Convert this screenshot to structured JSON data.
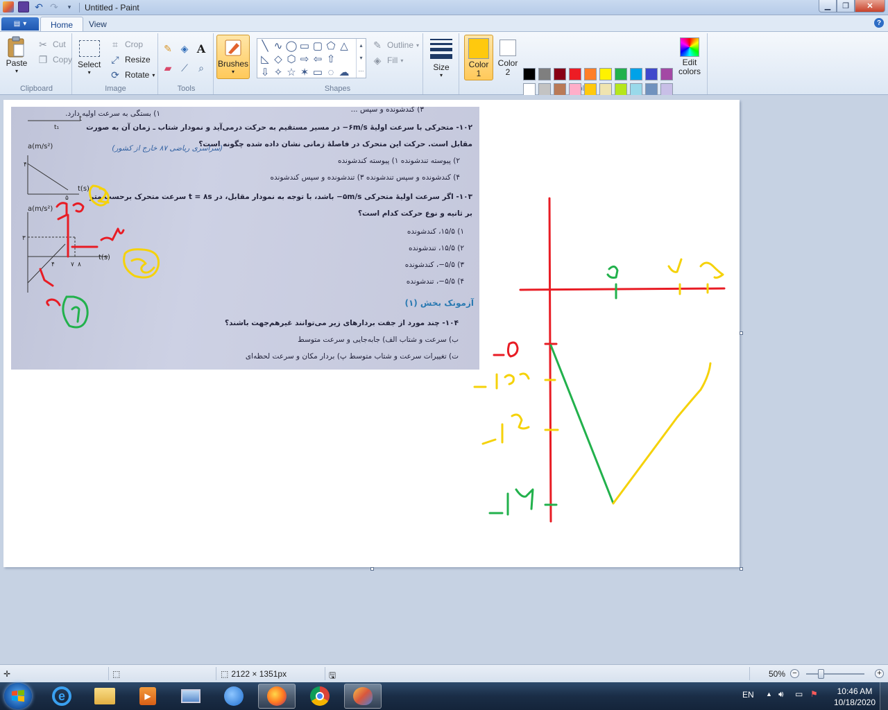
{
  "window": {
    "title": "Untitled - Paint",
    "controls": {
      "minimize": "minimize-icon",
      "maximize": "maximize-icon",
      "close": "close-icon"
    }
  },
  "quick_access": [
    "save-icon",
    "undo-icon",
    "redo-icon",
    "customize-icon"
  ],
  "tabs": [
    {
      "label": "Home",
      "active": true
    },
    {
      "label": "View",
      "active": false
    }
  ],
  "ribbon": {
    "clipboard": {
      "label": "Clipboard",
      "paste": "Paste",
      "cut": "Cut",
      "copy": "Copy"
    },
    "image": {
      "label": "Image",
      "select": "Select",
      "crop": "Crop",
      "resize": "Resize",
      "rotate": "Rotate"
    },
    "tools": {
      "label": "Tools",
      "items": [
        "pencil-icon",
        "fill-bucket-icon",
        "text-icon",
        "eraser-icon",
        "color-picker-icon",
        "magnifier-icon"
      ],
      "text_glyph": "A"
    },
    "brushes": {
      "label": "Brushes"
    },
    "shapes": {
      "label": "Shapes",
      "outline": "Outline",
      "fill": "Fill",
      "glyphs": [
        "╲",
        "∿",
        "◯",
        "▭",
        "▢",
        "⬠",
        "△",
        "◺",
        "◇",
        "⬡",
        "⇨",
        "⇦",
        "⇧",
        "⇩",
        "✧",
        "☆",
        "✶",
        "▭",
        "◌",
        "☁"
      ]
    },
    "size": {
      "label": "Size"
    },
    "colors": {
      "label": "Colors",
      "color1_label": "Color",
      "color1_num": "1",
      "color2_label": "Color",
      "color2_num": "2",
      "color1_value": "#ffc90e",
      "color2_value": "#ffffff",
      "edit_label": "Edit",
      "edit_label2": "colors",
      "palette_row1": [
        "#000000",
        "#7f7f7f",
        "#880015",
        "#ed1c24",
        "#ff7f27",
        "#fff200",
        "#22b14c",
        "#00a2e8",
        "#3f48cc",
        "#a349a4"
      ],
      "palette_row2": [
        "#ffffff",
        "#c3c3c3",
        "#b97a57",
        "#ffaec9",
        "#ffc90e",
        "#efe4b0",
        "#b5e61d",
        "#99d9ea",
        "#7092be",
        "#c8bfe7"
      ]
    }
  },
  "photo": {
    "lines": [
      {
        "t": "۳) کندشونده و سپس ...",
        "b": false
      },
      {
        "t": "۱) بستگی به سرعت اولیه دارد.",
        "b": false
      },
      {
        "t": "۱۰۲- متحرکی با سرعت اولیهٔ ۶m/s− در مسیر مستقیم به حرکت درمی‌آید و نمودار شتاب ـ زمان آن به صورت",
        "b": true
      },
      {
        "t": "مقابل است. حرکت این متحرک در فاصلهٔ زمانی نشان داده شده چگونه است؟",
        "b": true
      },
      {
        "t": "(سراسری ریاضی ۸۷ خارج از کشور)",
        "b": false,
        "blue": true
      },
      {
        "t": "۲) پیوسته تندشونده        ۱) پیوسته کندشونده",
        "b": false
      },
      {
        "t": "۴) کندشونده و سپس تندشونده        ۳) تندشونده و سپس کندشونده",
        "b": false
      },
      {
        "t": "۱۰۳- اگر سرعت اولیهٔ متحرکی ۵m/s− باشد، با توجه به نمودار مقابل، در t = ۸s سرعت متحرک برحسب متر",
        "b": true
      },
      {
        "t": "بر ثانیه و نوع حرکت کدام است؟",
        "b": true
      },
      {
        "t": "۱) ۱۵/۵، کندشونده",
        "b": false
      },
      {
        "t": "۲) ۱۵/۵، تندشونده",
        "b": false
      },
      {
        "t": "۳) ۵/۵−، کندشونده",
        "b": false
      },
      {
        "t": "۴) ۵/۵−، تندشونده",
        "b": false
      },
      {
        "t": "آزمونک بخش (۱)",
        "b": true,
        "heading": true
      },
      {
        "t": "۱۰۴- چند مورد از جفت بردارهای زیر می‌توانند غیرهم‌جهت باشند؟",
        "b": true
      },
      {
        "t": "ب) سرعت و شتاب        الف) جابه‌جایی و سرعت متوسط",
        "b": false
      },
      {
        "t": "ت) تغییرات سرعت و شتاب متوسط        پ) بردار مکان و سرعت لحظه‌ای",
        "b": false
      }
    ],
    "graph_labels": {
      "a1": "a(m/s²)",
      "t1": "t(s)",
      "a2": "a(m/s²)",
      "t2": "t(s)",
      "t": "t",
      "t1sub": "t₁",
      "four": "۴",
      "five": "۵",
      "three": "۳",
      "seven": "۷",
      "eight": "۸",
      "four2": "۴"
    }
  },
  "statusbar": {
    "dimensions": "2122 × 1351px",
    "zoom": "50%"
  },
  "taskbar": {
    "apps": [
      "internet-explorer-icon",
      "file-explorer-icon",
      "media-player-icon",
      "remote-desktop-icon",
      "browser-icon",
      "firefox-icon",
      "chrome-icon",
      "paint-icon"
    ],
    "language": "EN",
    "time": "10:46 AM",
    "date": "10/18/2020"
  }
}
